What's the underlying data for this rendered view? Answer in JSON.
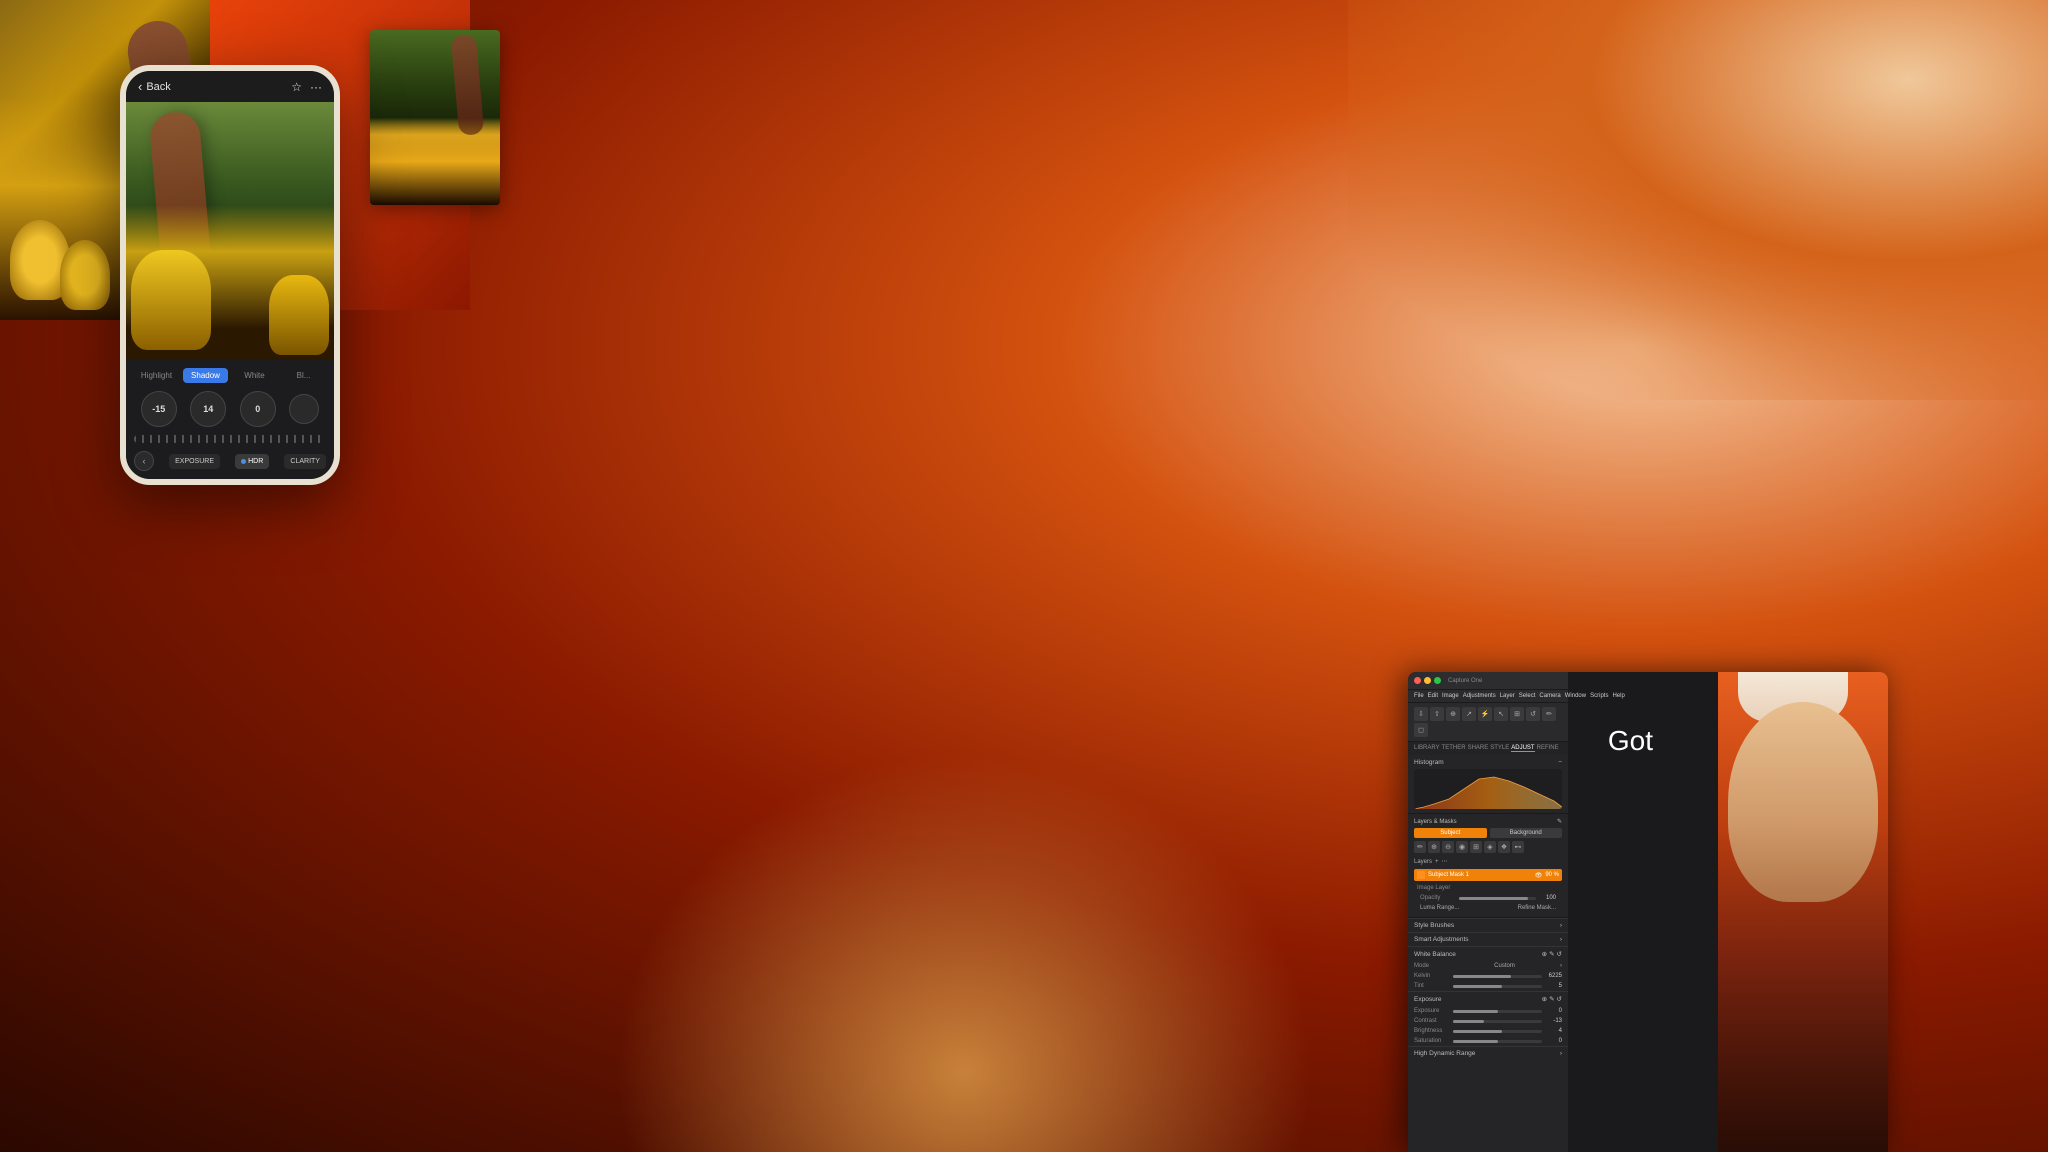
{
  "background": {
    "colors": {
      "primary": "#c0380a",
      "secondary": "#8b1a00",
      "accent": "#f5c49a"
    }
  },
  "phone": {
    "back_label": "Back",
    "tabs": [
      "Highlight",
      "Shadow",
      "White",
      "Bl..."
    ],
    "active_tab": "Shadow",
    "knobs": [
      "-15",
      "14",
      "0",
      ""
    ],
    "buttons": {
      "exposure": "EXPOSURE",
      "hdr": "HDR",
      "clarity": "CLARITY"
    }
  },
  "software": {
    "app_name": "Capture One",
    "menu_items": [
      "File",
      "Edit",
      "Image",
      "Adjustments",
      "Layer",
      "Select",
      "Camera",
      "Window",
      "Scripts",
      "Help"
    ],
    "tabs": [
      "LIBRARY",
      "TETHER",
      "SHARE",
      "STYLE",
      "ADJUST",
      "REFINE"
    ],
    "active_tab": "ADJUST",
    "sections": {
      "histogram": "Histogram",
      "layers_masks": "Layers & Masks",
      "subject": "Subject",
      "background": "Background",
      "layers_label": "Layers",
      "layer_name": "Subject Mask 1",
      "layer_opacity": "90 %",
      "image_layer": "Image Layer",
      "opacity_label": "Opacity",
      "opacity_value": "100",
      "luma_range": "Luma Range...",
      "refine_mask": "Refine Mask...",
      "style_brushes": "Style Brushes",
      "smart_adjustments": "Smart Adjustments",
      "white_balance": "White Balance",
      "mode_label": "Mode",
      "mode_value": "Custom",
      "kelvin_label": "Kelvin",
      "kelvin_value": "6225",
      "tint_label": "Tint",
      "tint_value": "5",
      "exposure_section": "Exposure",
      "exposure_label": "Exposure",
      "exposure_value": "0",
      "contrast_label": "Contrast",
      "contrast_value": "-13",
      "brightness_label": "Brightness",
      "brightness_value": "4",
      "saturation_label": "Saturation",
      "saturation_value": "0",
      "high_dynamic_range": "High Dynamic Range"
    },
    "subject_mask_label": "Subject Mask 1"
  },
  "overlay_text": {
    "got": "Got"
  }
}
